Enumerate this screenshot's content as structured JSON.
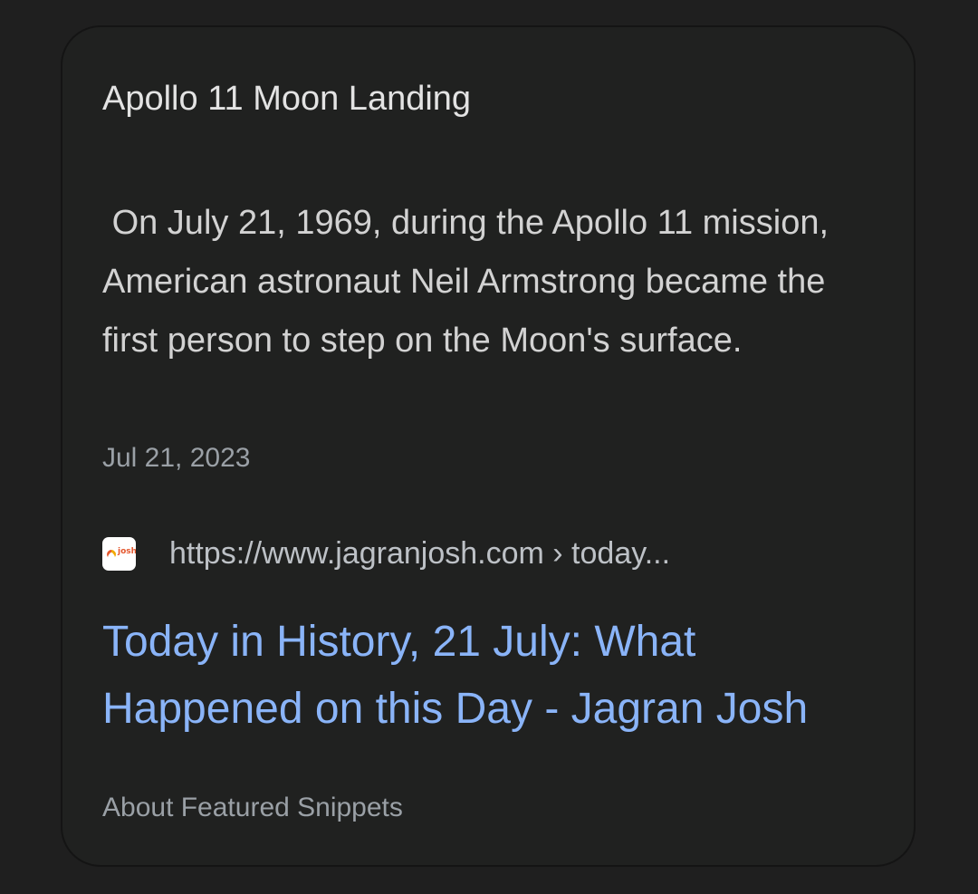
{
  "snippet": {
    "heading": "Apollo 11 Moon Landing",
    "text": " On July 21, 1969, during the Apollo 11 mission, American astronaut Neil Armstrong became the first person to step on the Moon's surface.",
    "date": "Jul 21, 2023"
  },
  "source": {
    "favicon_icon": "jagranjosh-logo-icon",
    "favicon_text": "josh",
    "url": "https://www.jagranjosh.com › today...",
    "title": "Today in History, 21 July: What Happened on this Day - Jagran Josh"
  },
  "footer": {
    "about_label": "About Featured Snippets"
  },
  "colors": {
    "background": "#1f1f1f",
    "card": "#202120",
    "link": "#8ab4f8",
    "muted": "#9aa0a6",
    "text": "#e3e3e3"
  }
}
